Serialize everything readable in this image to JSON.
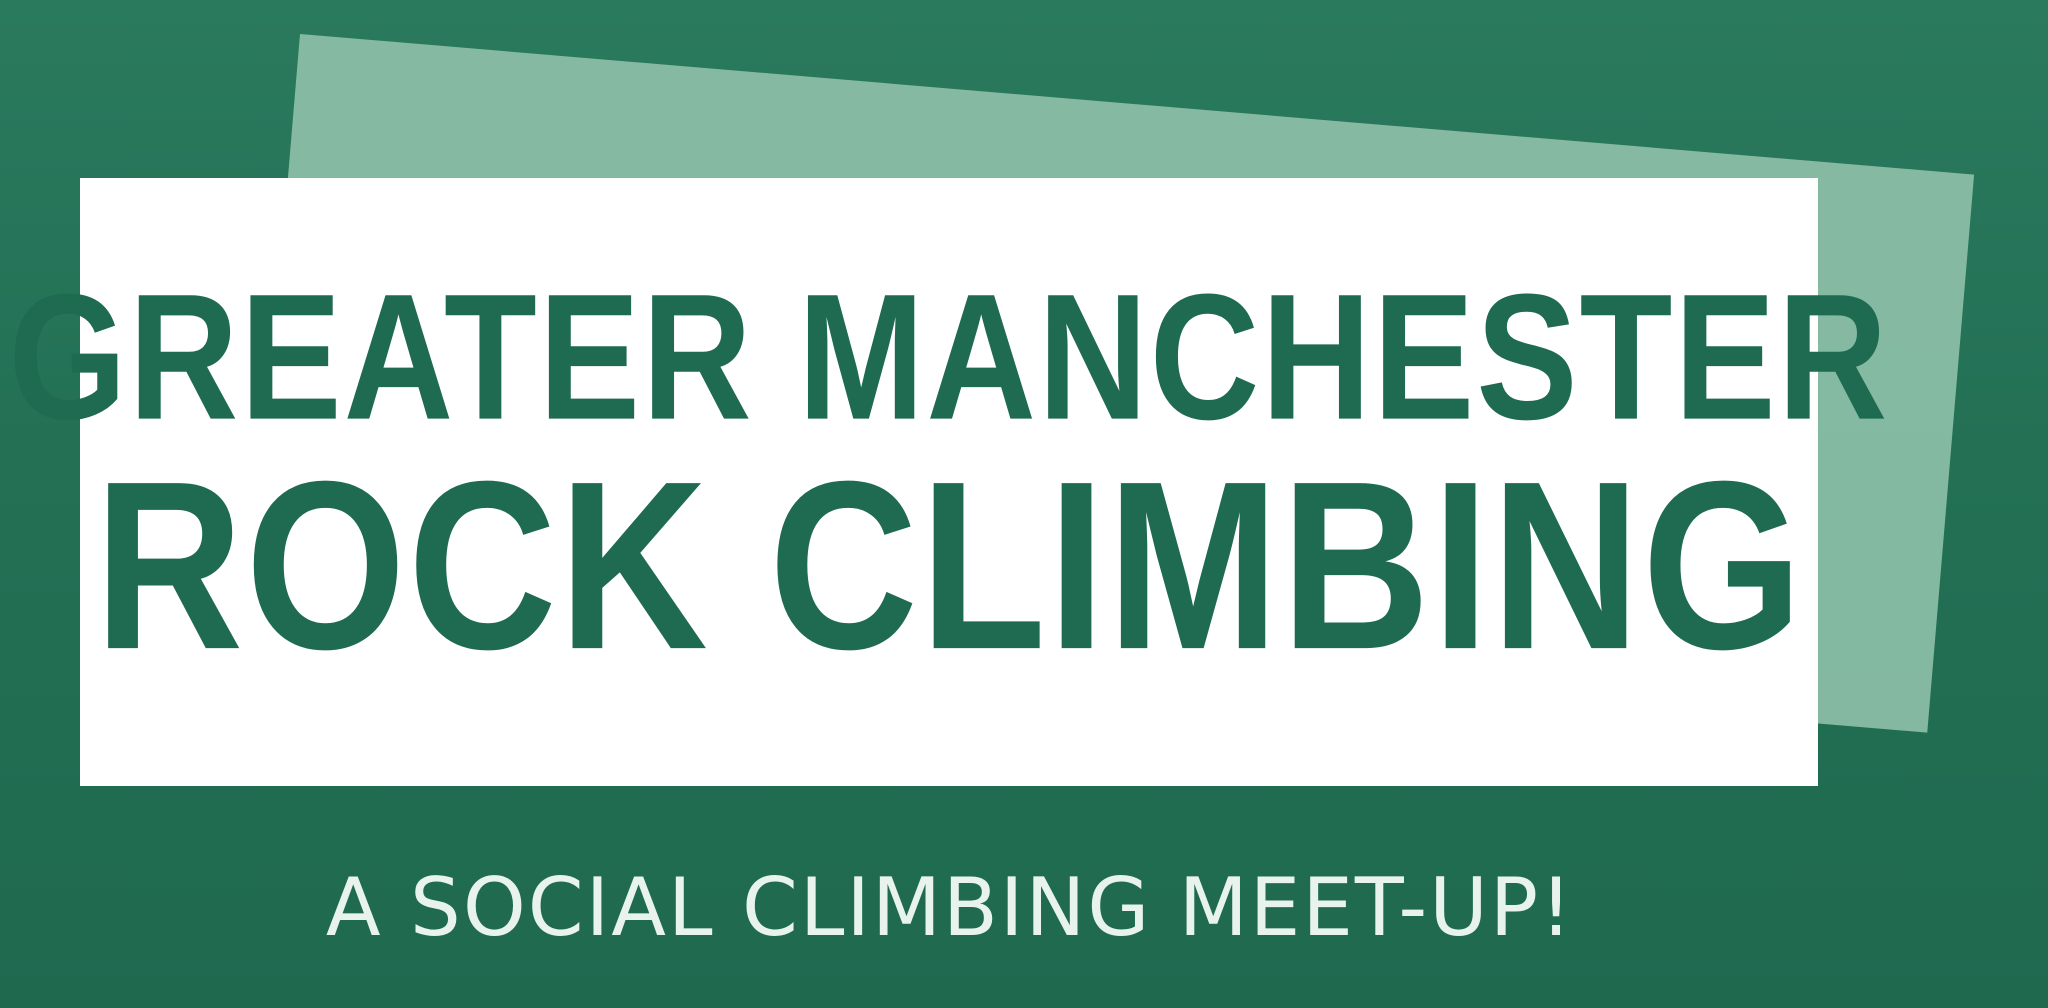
{
  "banner": {
    "title_line_1": "GREATER MANCHESTER",
    "title_line_2": "ROCK CLIMBING",
    "tagline": "A SOCIAL CLIMBING MEET-UP!"
  },
  "colors": {
    "background": "#237055",
    "tilted_panel": "#8dbfa8",
    "title_box": "#ffffff",
    "title_text": "#1f6b52",
    "tagline_text": "#e8f3ee"
  }
}
